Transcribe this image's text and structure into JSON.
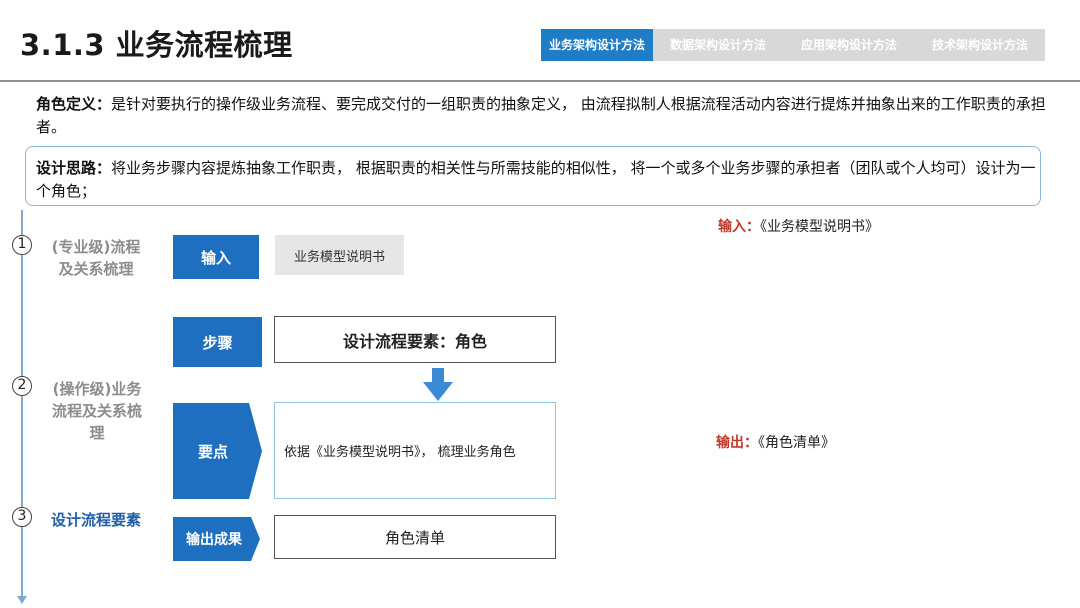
{
  "header": {
    "title": "3.1.3 业务流程梳理",
    "tabs": [
      {
        "label": "业务架构设计方法",
        "active": true
      },
      {
        "label": "数据架构设计方法",
        "active": false
      },
      {
        "label": "应用架构设计方法",
        "active": false
      },
      {
        "label": "技术架构设计方法",
        "active": false
      }
    ]
  },
  "role_definition": {
    "label": "角色定义：",
    "text": "是针对要执行的操作级业务流程、要完成交付的一组职责的抽象定义， 由流程拟制人根据流程活动内容进行提炼并抽象出来的工作职责的承担者。"
  },
  "design_idea": {
    "label": "设计思路：",
    "text": "将业务步骤内容提炼抽象工作职责， 根据职责的相关性与所需技能的相似性， 将一个或多个业务步骤的承担者（团队或个人均可）设计为一个角色；"
  },
  "steps": [
    {
      "num": "1",
      "label": "(专业级)流程及关系梳理",
      "active": false
    },
    {
      "num": "2",
      "label": "(操作级)业务流程及关系梳理",
      "active": false
    },
    {
      "num": "3",
      "label": "设计流程要素",
      "active": true
    }
  ],
  "flow": {
    "input_label": "输入",
    "input_value": "业务模型说明书",
    "step_label": "步骤",
    "step_value": "设计流程要素：角色",
    "points_label": "要点",
    "points_value": "依据《业务模型说明书》， 梳理业务角色",
    "output_label": "输出成果",
    "output_value": "角色清单"
  },
  "io": {
    "input_tag": "输入：",
    "input_doc": "《业务模型说明书》",
    "output_tag": "输出：",
    "output_doc": "《角色清单》"
  },
  "colors": {
    "accent_blue": "#1e6fc0",
    "tab_active": "#1f7dc8",
    "tab_inactive": "#d8d8d8",
    "io_label_red": "#c0392b",
    "step_active": "#1f5ea8"
  }
}
